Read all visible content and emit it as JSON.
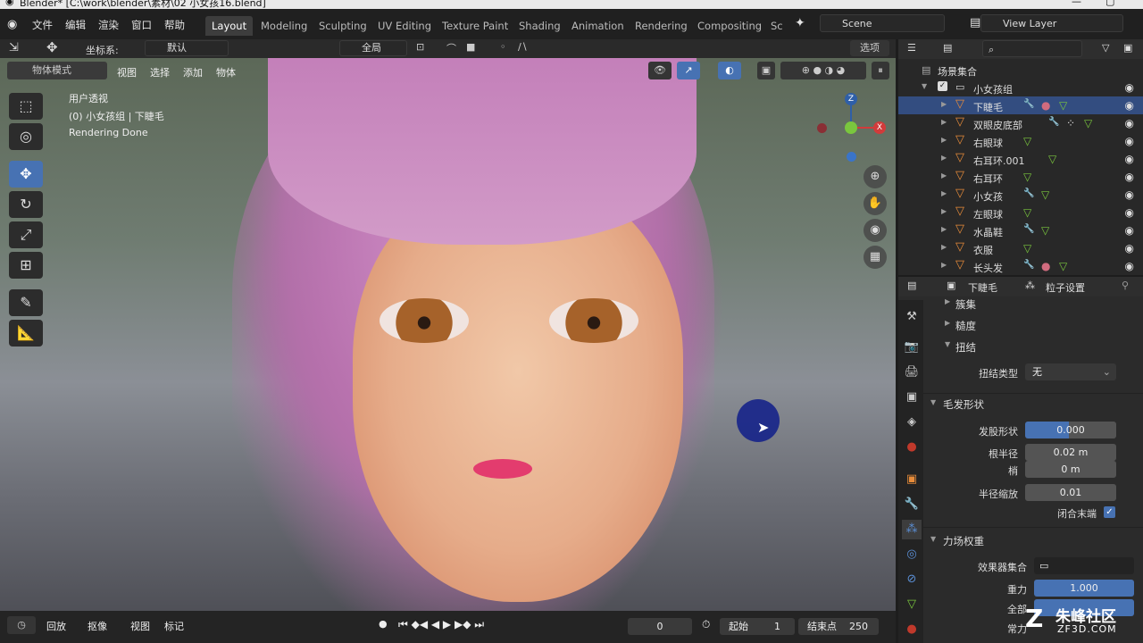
{
  "window_title": "Blender* [C:\\work\\blender\\素材\\02 小女孩16.blend]",
  "menu": [
    "文件",
    "编辑",
    "渲染",
    "窗口",
    "帮助"
  ],
  "workspaces": [
    "Layout",
    "Modeling",
    "Sculpting",
    "UV Editing",
    "Texture Paint",
    "Shading",
    "Animation",
    "Rendering",
    "Compositing",
    "Sc"
  ],
  "scene": "Scene",
  "view_layer": "View Layer",
  "toolbar": {
    "coord_label": "坐标系:",
    "coord_value": "默认",
    "pivot": "全局",
    "options": "选项"
  },
  "viewport_header": {
    "mode": "物体模式",
    "items": [
      "视图",
      "选择",
      "添加",
      "物体"
    ]
  },
  "overlay_text": {
    "view": "用户透视",
    "object": "(0) 小女孩组 | 下睫毛",
    "status": "Rendering Done"
  },
  "gizmo": {
    "z": "Z",
    "x": "X"
  },
  "timeline": {
    "items": [
      "回放",
      "抠像",
      "视图",
      "标记"
    ],
    "current": "0",
    "start_label": "起始",
    "start": "1",
    "end_label": "结束点",
    "end": "250"
  },
  "outliner": {
    "root": "场景集合",
    "collection": "小女孩组",
    "items": [
      {
        "name": "下睫毛",
        "selected": true
      },
      {
        "name": "双眼皮底部"
      },
      {
        "name": "右眼球"
      },
      {
        "name": "右耳环.001"
      },
      {
        "name": "右耳环"
      },
      {
        "name": "小女孩"
      },
      {
        "name": "左眼球"
      },
      {
        "name": "水晶鞋"
      },
      {
        "name": "衣服"
      },
      {
        "name": "长头发"
      }
    ]
  },
  "properties": {
    "object": "下睫毛",
    "particle_settings": "粒子设置",
    "panels": [
      "簇集",
      "糙度",
      "扭结"
    ],
    "kink_type_label": "扭结类型",
    "kink_type": "无",
    "hair_shape_title": "毛发形状",
    "fields": [
      {
        "label": "发股形状",
        "value": "0.000"
      },
      {
        "label": "根半径",
        "value": "0.02 m"
      },
      {
        "label": "梢",
        "value": "0 m"
      },
      {
        "label": "半径缩放",
        "value": "0.01"
      }
    ],
    "close_tip_label": "闭合末端",
    "force_title": "力场权重",
    "effector_label": "效果器集合",
    "gravity_label": "重力",
    "gravity": "1.000",
    "all_label": "全部",
    "const_label": "常力"
  },
  "watermark": {
    "brand": "朱峰社区",
    "url": "ZF3D.COM"
  }
}
